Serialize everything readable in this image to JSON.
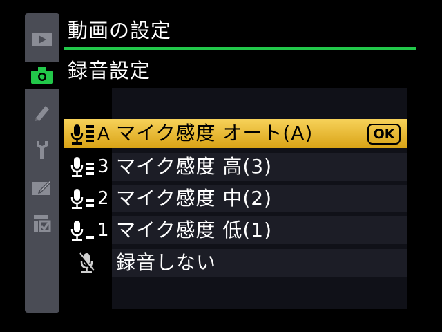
{
  "menu": {
    "title": "動画の設定",
    "subtitle": "録音設定"
  },
  "sidebar": {
    "tabs": [
      {
        "icon": "playback-icon",
        "active": false
      },
      {
        "icon": "camera-icon",
        "active": true
      },
      {
        "icon": "pencil-icon",
        "active": false
      },
      {
        "icon": "wrench-icon",
        "active": false
      },
      {
        "icon": "retouch-icon",
        "active": false
      },
      {
        "icon": "my-menu-icon",
        "active": false
      }
    ]
  },
  "options": [
    {
      "level": "A",
      "label": "マイク感度 オート(A)",
      "selected": true,
      "ok": "OK"
    },
    {
      "level": "3",
      "label": "マイク感度 高(3)",
      "selected": false
    },
    {
      "level": "2",
      "label": "マイク感度 中(2)",
      "selected": false
    },
    {
      "level": "1",
      "label": "マイク感度 低(1)",
      "selected": false
    },
    {
      "level": "",
      "label": "録音しない",
      "selected": false
    }
  ],
  "colors": {
    "accent": "#22c84a",
    "selection": "#e8b838",
    "sidebar": "#4a4c55"
  }
}
